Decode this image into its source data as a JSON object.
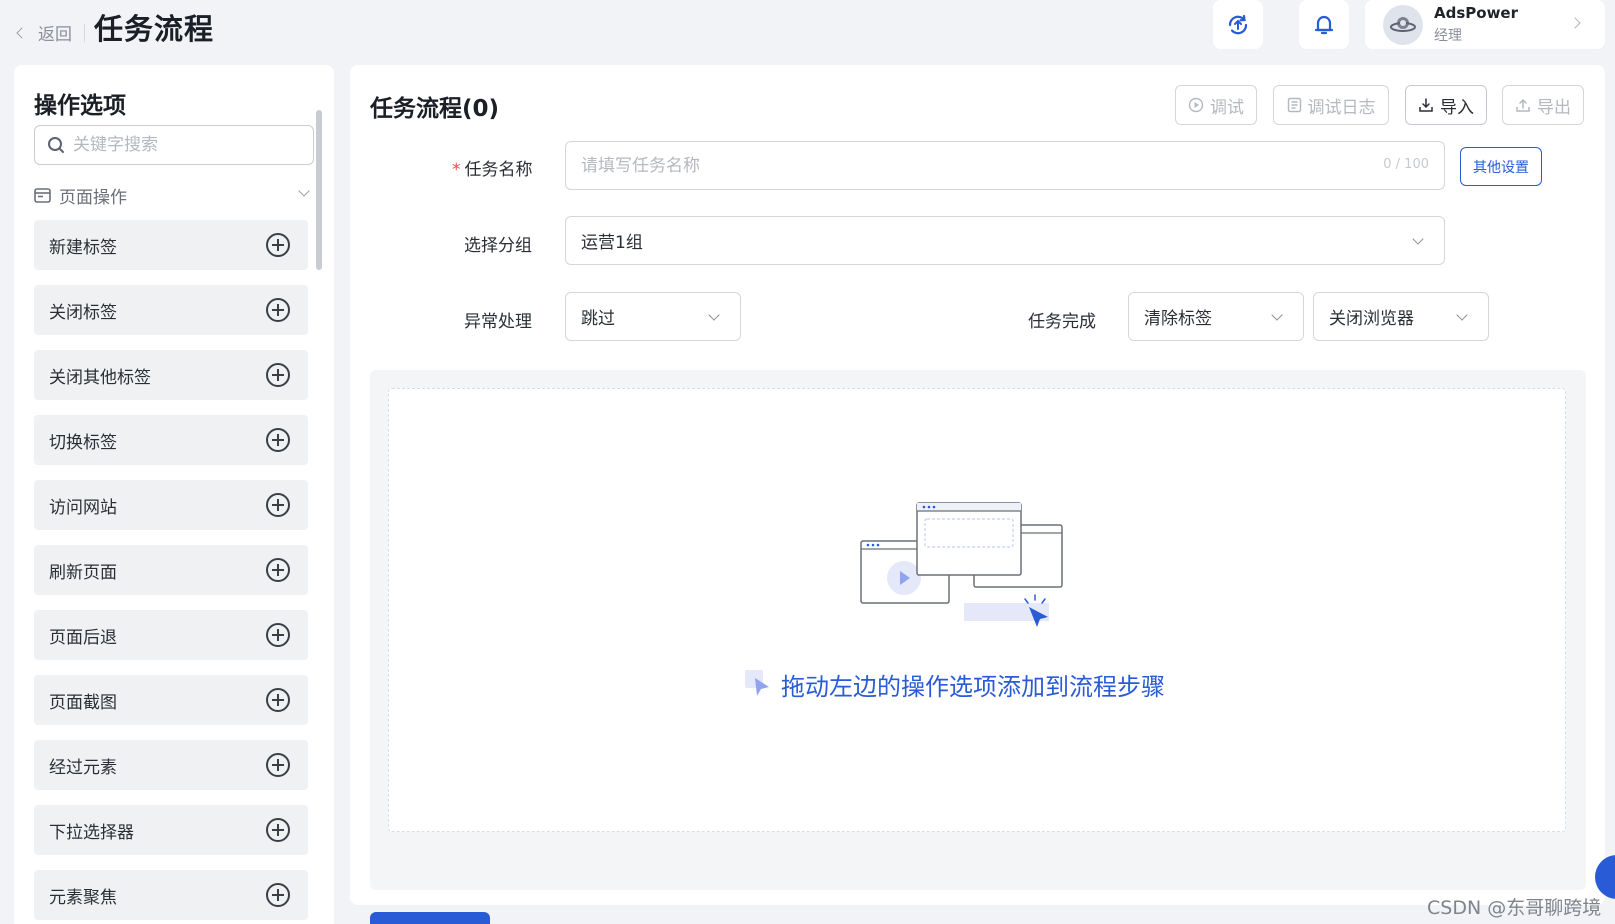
{
  "header": {
    "back_label": "返回",
    "title": "任务流程",
    "sync_icon": "sync-icon",
    "bell_icon": "bell-icon",
    "user": {
      "name": "AdsPower",
      "role": "经理"
    }
  },
  "sidebar": {
    "title": "操作选项",
    "search_placeholder": "关键字搜索",
    "group_label": "页面操作",
    "items": [
      {
        "label": "新建标签"
      },
      {
        "label": "关闭标签"
      },
      {
        "label": "关闭其他标签"
      },
      {
        "label": "切换标签"
      },
      {
        "label": "访问网站"
      },
      {
        "label": "刷新页面"
      },
      {
        "label": "页面后退"
      },
      {
        "label": "页面截图"
      },
      {
        "label": "经过元素"
      },
      {
        "label": "下拉选择器"
      },
      {
        "label": "元素聚焦"
      }
    ]
  },
  "main": {
    "title": "任务流程(0)",
    "toolbar": {
      "debug_label": "调试",
      "debug_log_label": "调试日志",
      "import_label": "导入",
      "export_label": "导出"
    },
    "form": {
      "task_name_label": "任务名称",
      "task_name_placeholder": "请填写任务名称",
      "task_name_counter": "0 / 100",
      "other_settings_label": "其他设置",
      "group_label": "选择分组",
      "group_value": "运营1组",
      "exception_label": "异常处理",
      "exception_value": "跳过",
      "complete_label": "任务完成",
      "complete_value_1": "清除标签",
      "complete_value_2": "关闭浏览器"
    },
    "empty_hint": "拖动左边的操作选项添加到流程步骤"
  },
  "watermark": "CSDN @东哥聊跨境",
  "colors": {
    "primary": "#2a5bd7",
    "required": "#e5484d",
    "background": "#f2f3f6"
  }
}
